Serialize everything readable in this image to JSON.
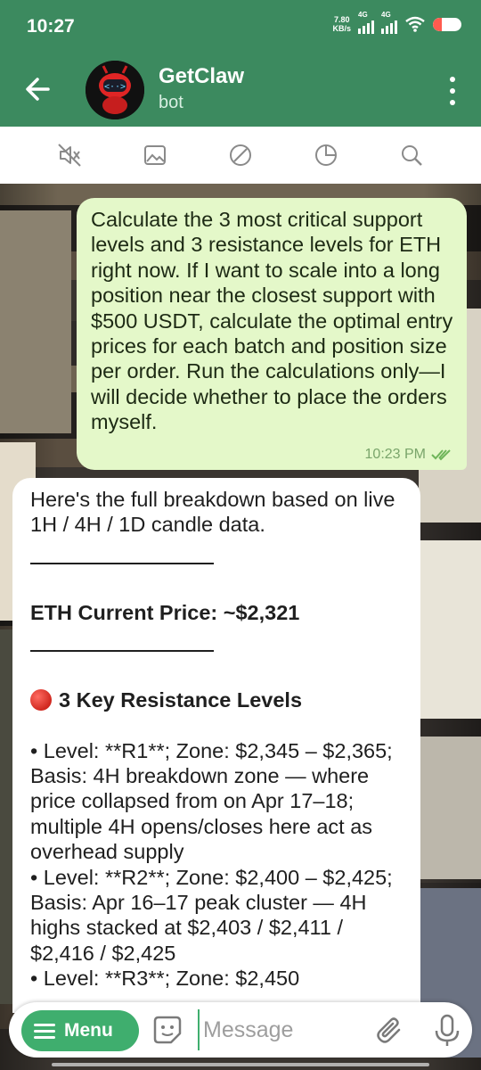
{
  "status_bar": {
    "time": "10:27",
    "net_speed": "7.80",
    "net_unit": "KB/s",
    "sim1": "4G",
    "sim2": "4G",
    "battery_level": 0.3
  },
  "header": {
    "title": "GetClaw",
    "subtitle": "bot"
  },
  "toolbar": {
    "items": [
      "mute-icon",
      "gallery-icon",
      "block-icon",
      "stats-icon",
      "search-icon"
    ]
  },
  "messages": {
    "outgoing": {
      "text": "Calculate the 3 most critical support levels and 3 resistance levels for ETH right now. If I want to scale into a long position near the closest support with $500 USDT, calculate the optimal entry prices for each batch and position size per order. Run the calculations only—I will decide whether to place the orders myself.",
      "time": "10:23 PM",
      "status": "read"
    },
    "incoming": {
      "intro": "Here's the full breakdown based on live 1H / 4H / 1D candle data.",
      "price_line": "ETH Current Price: ~$2,321",
      "resistance_heading": "3 Key Resistance Levels",
      "r1": "• Level: **R1**; Zone: $2,345 – $2,365; Basis: 4H breakdown zone — where price collapsed from on Apr 17–18; multiple 4H opens/closes here act as overhead supply",
      "r2": "• Level: **R2**; Zone: $2,400 – $2,425; Basis: Apr 16–17 peak cluster — 4H highs stacked at $2,403 / $2,411 / $2,416 / $2,425",
      "r3_partial": "• Level: **R3**; Zone: $2,450"
    }
  },
  "composer": {
    "menu_label": "Menu",
    "placeholder": "Message"
  },
  "colors": {
    "header": "#3c8a5f",
    "accent": "#3fae6e",
    "outgoing_bubble": "#e4f8c9",
    "incoming_bubble": "#ffffff"
  }
}
